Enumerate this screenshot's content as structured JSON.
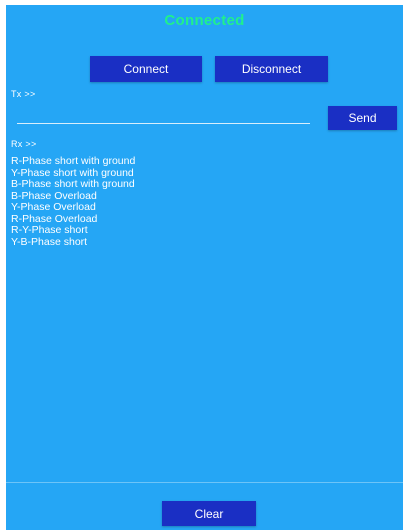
{
  "status": {
    "text": "Connected",
    "color": "#20f08c"
  },
  "buttons": {
    "connect": "Connect",
    "disconnect": "Disconnect",
    "send": "Send",
    "clear": "Clear"
  },
  "tx": {
    "label": "Tx >>",
    "value": ""
  },
  "rx": {
    "label": "Rx >>",
    "messages": [
      "R-Phase short with ground",
      "Y-Phase short with ground",
      "B-Phase short with ground",
      "B-Phase Overload",
      "Y-Phase Overload",
      "R-Phase Overload",
      "R-Y-Phase short",
      "Y-B-Phase short"
    ]
  },
  "colors": {
    "background": "#25a6f5",
    "button": "#1a2fc4",
    "text": "#ffffff"
  }
}
